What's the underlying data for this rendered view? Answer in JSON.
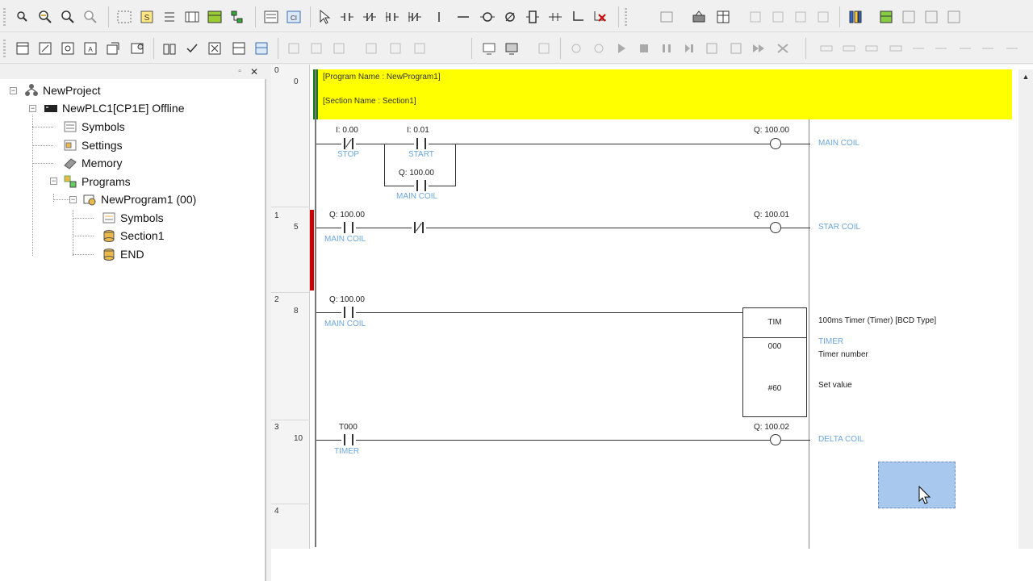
{
  "tree": {
    "project": "NewProject",
    "plc": "NewPLC1[CP1E] Offline",
    "plc_children": [
      "Symbols",
      "Settings",
      "Memory",
      "Programs"
    ],
    "program": "NewProgram1 (00)",
    "program_children": [
      "Symbols",
      "Section1",
      "END"
    ]
  },
  "ladder": {
    "header": {
      "program_name": "[Program Name : NewProgram1]",
      "section_name": "[Section Name : Section1]"
    },
    "rungs": [
      {
        "rung": "0",
        "step": "0",
        "contacts": [
          {
            "addr": "I: 0.00",
            "sym": "STOP"
          },
          {
            "addr": "I: 0.01",
            "sym": "START"
          },
          {
            "addr": "Q: 100.00",
            "sym": "MAIN COIL"
          }
        ],
        "coil": {
          "addr": "Q: 100.00",
          "comment": "MAIN COIL"
        }
      },
      {
        "rung": "1",
        "step": "5",
        "contacts": [
          {
            "addr": "Q: 100.00",
            "sym": "MAIN COIL"
          }
        ],
        "coil": {
          "addr": "Q: 100.01",
          "comment": "STAR COIL"
        }
      },
      {
        "rung": "2",
        "step": "8",
        "contacts": [
          {
            "addr": "Q: 100.00",
            "sym": "MAIN COIL"
          }
        ],
        "timer": {
          "label": "TIM",
          "number": "000",
          "set_value": "#60",
          "comment": "100ms Timer (Timer) [BCD Type]",
          "sym": "TIMER",
          "number_label": "Timer number",
          "set_label": "Set value"
        }
      },
      {
        "rung": "3",
        "step": "10",
        "contacts": [
          {
            "addr": "T000",
            "sym": "TIMER"
          }
        ],
        "coil": {
          "addr": "Q: 100.02",
          "comment": "DELTA COIL"
        }
      },
      {
        "rung": "4"
      }
    ]
  },
  "colors": {
    "header_bg": "#ffff00",
    "header_stripe": "#1a7a1a",
    "rung_marker": "#cc0000",
    "symbol_text": "#6aa6dc",
    "selection": "#a8c8ee"
  }
}
